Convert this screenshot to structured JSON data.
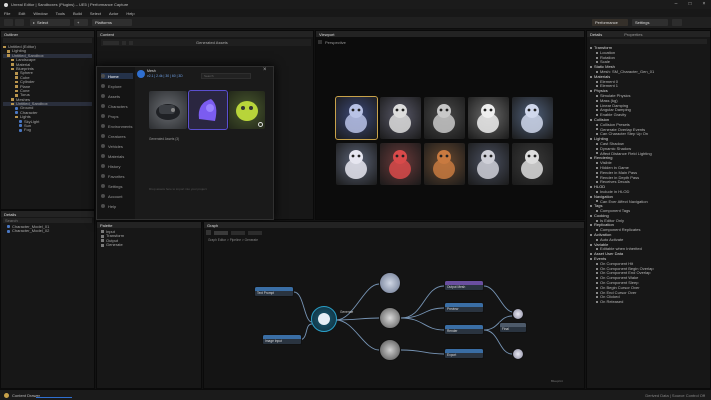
{
  "window": {
    "title": "Unreal Editor | Sandboxes (Plugins) – UE5 | Performance Capture"
  },
  "menu": [
    "File",
    "Edit",
    "Window",
    "Tools",
    "Build",
    "Select",
    "Actor",
    "Help"
  ],
  "toolbar": {
    "mode_label": "Select",
    "platform_label": "Platforms",
    "right_buttons": [
      "Performance",
      "Settings"
    ]
  },
  "outliner": {
    "title": "Outliner",
    "tree": [
      {
        "indent": 0,
        "label": "Untitled (Editor)",
        "type": "folder",
        "selected": false
      },
      {
        "indent": 1,
        "label": "Lighting",
        "type": "folder",
        "selected": false
      },
      {
        "indent": 1,
        "label": "Untitled_Sandbox",
        "type": "folder",
        "selected": true
      },
      {
        "indent": 2,
        "label": "Landscape",
        "type": "folder",
        "selected": false
      },
      {
        "indent": 2,
        "label": "Material",
        "type": "folder",
        "selected": false
      },
      {
        "indent": 2,
        "label": "Blueprints",
        "type": "folder",
        "selected": false
      },
      {
        "indent": 3,
        "label": "Sphere",
        "type": "folder",
        "selected": false
      },
      {
        "indent": 3,
        "label": "Cube",
        "type": "folder",
        "selected": false
      },
      {
        "indent": 3,
        "label": "Cylinder",
        "type": "folder",
        "selected": false
      },
      {
        "indent": 3,
        "label": "Plane",
        "type": "folder",
        "selected": false
      },
      {
        "indent": 3,
        "label": "Cone",
        "type": "folder",
        "selected": false
      },
      {
        "indent": 3,
        "label": "Torus",
        "type": "folder",
        "selected": false
      },
      {
        "indent": 2,
        "label": "Meshes",
        "type": "folder",
        "selected": false
      },
      {
        "indent": 2,
        "label": "Untitled_Sandbox",
        "type": "folder",
        "selected": true
      },
      {
        "indent": 3,
        "label": "Ground",
        "type": "blue",
        "selected": false
      },
      {
        "indent": 3,
        "label": "Character",
        "type": "blue",
        "selected": false
      },
      {
        "indent": 3,
        "label": "Lights",
        "type": "folder",
        "selected": false
      },
      {
        "indent": 4,
        "label": "SkyLight",
        "type": "blue",
        "selected": false
      },
      {
        "indent": 4,
        "label": "Sun",
        "type": "blue",
        "selected": false
      },
      {
        "indent": 4,
        "label": "Fog",
        "type": "blue",
        "selected": false
      }
    ]
  },
  "details_left": {
    "title": "Details",
    "search_placeholder": "Search",
    "rows": [
      "Character_Model_01",
      "Character_Model_02"
    ]
  },
  "content_panel": {
    "title": "Content",
    "tab_label": "Generated Assets"
  },
  "modal": {
    "brand": "Mesh",
    "brand_sub": "v2.1 | 2.4k | 30 | 60 | 3D",
    "search_placeholder": "Search",
    "close": "×",
    "nav": [
      "Home",
      "Explore",
      "Assets",
      "Characters",
      "Props",
      "Environments",
      "Creatures",
      "Vehicles",
      "Materials",
      "History",
      "Favorites",
      "Settings",
      "Account",
      "Help"
    ],
    "selected_nav": "Home",
    "caption": "Generated Assets (3)",
    "footer": "Drop assets here to import into your project"
  },
  "viewport": {
    "title": "Viewport",
    "tab_label": "Perspective",
    "grid_count": 10
  },
  "graph_left": {
    "title": "Palette",
    "rows": [
      "Input",
      "Transform",
      "Output",
      "Generate"
    ]
  },
  "graph": {
    "title": "Graph",
    "subtitle": "Node Graph",
    "breadcrumb": "Graph Editor > Pipeline > Generate",
    "nodes": [
      "Text Prompt",
      "Image Input",
      "Generate",
      "Model",
      "Style",
      "Reference",
      "Output Mesh",
      "Preview",
      "Render",
      "Export",
      "Final",
      "Merge"
    ],
    "zoom_label": "Zoom 1:1",
    "footer": "Blueprint"
  },
  "right_panel": {
    "title": "Details",
    "tab": "Properties",
    "rows": [
      {
        "indent": 0,
        "label": "Transform"
      },
      {
        "indent": 1,
        "label": "Location"
      },
      {
        "indent": 1,
        "label": "Rotation"
      },
      {
        "indent": 1,
        "label": "Scale"
      },
      {
        "indent": 0,
        "label": "Static Mesh"
      },
      {
        "indent": 1,
        "label": "Mesh: SM_Character_Gen_01"
      },
      {
        "indent": 0,
        "label": "Materials"
      },
      {
        "indent": 1,
        "label": "Element 0"
      },
      {
        "indent": 1,
        "label": "Element 1"
      },
      {
        "indent": 0,
        "label": "Physics"
      },
      {
        "indent": 1,
        "label": "Simulate Physics"
      },
      {
        "indent": 1,
        "label": "Mass (kg)"
      },
      {
        "indent": 1,
        "label": "Linear Damping"
      },
      {
        "indent": 1,
        "label": "Angular Damping"
      },
      {
        "indent": 1,
        "label": "Enable Gravity"
      },
      {
        "indent": 0,
        "label": "Collision"
      },
      {
        "indent": 1,
        "label": "Collision Presets"
      },
      {
        "indent": 1,
        "label": "Generate Overlap Events"
      },
      {
        "indent": 1,
        "label": "Can Character Step Up On"
      },
      {
        "indent": 0,
        "label": "Lighting"
      },
      {
        "indent": 1,
        "label": "Cast Shadow"
      },
      {
        "indent": 1,
        "label": "Dynamic Shadow"
      },
      {
        "indent": 1,
        "label": "Affect Distance Field Lighting"
      },
      {
        "indent": 0,
        "label": "Rendering"
      },
      {
        "indent": 1,
        "label": "Visible"
      },
      {
        "indent": 1,
        "label": "Hidden in Game"
      },
      {
        "indent": 1,
        "label": "Render in Main Pass"
      },
      {
        "indent": 1,
        "label": "Render in Depth Pass"
      },
      {
        "indent": 1,
        "label": "Receives Decals"
      },
      {
        "indent": 0,
        "label": "HLOD"
      },
      {
        "indent": 1,
        "label": "Include in HLOD"
      },
      {
        "indent": 0,
        "label": "Navigation"
      },
      {
        "indent": 1,
        "label": "Can Ever Affect Navigation"
      },
      {
        "indent": 0,
        "label": "Tags"
      },
      {
        "indent": 1,
        "label": "Component Tags"
      },
      {
        "indent": 0,
        "label": "Cooking"
      },
      {
        "indent": 1,
        "label": "Is Editor Only"
      },
      {
        "indent": 0,
        "label": "Replication"
      },
      {
        "indent": 1,
        "label": "Component Replicates"
      },
      {
        "indent": 0,
        "label": "Activation"
      },
      {
        "indent": 1,
        "label": "Auto Activate"
      },
      {
        "indent": 0,
        "label": "Variable"
      },
      {
        "indent": 1,
        "label": "Editable when Inherited"
      },
      {
        "indent": 0,
        "label": "Asset User Data"
      },
      {
        "indent": 0,
        "label": "Events"
      },
      {
        "indent": 1,
        "label": "On Component Hit"
      },
      {
        "indent": 1,
        "label": "On Component Begin Overlap"
      },
      {
        "indent": 1,
        "label": "On Component End Overlap"
      },
      {
        "indent": 1,
        "label": "On Component Wake"
      },
      {
        "indent": 1,
        "label": "On Component Sleep"
      },
      {
        "indent": 1,
        "label": "On Begin Cursor Over"
      },
      {
        "indent": 1,
        "label": "On End Cursor Over"
      },
      {
        "indent": 1,
        "label": "On Clicked"
      },
      {
        "indent": 1,
        "label": "On Released"
      }
    ]
  },
  "statusbar": {
    "left": "Content Drawer",
    "right": "Derived Data  |  Source Control Off"
  },
  "colors": {
    "accent": "#2f6fd0",
    "folder": "#b8944d",
    "node_blue": "#3a6ea5",
    "node_purple": "#6a4fa0"
  }
}
